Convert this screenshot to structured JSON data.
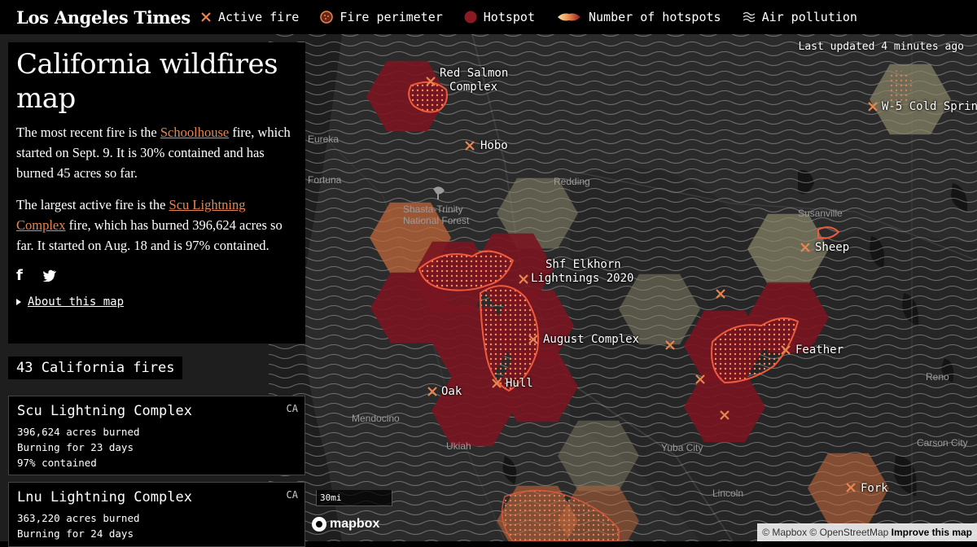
{
  "header": {
    "logo": "Los Angeles Times",
    "legend": [
      {
        "icon": "active-fire-x-icon",
        "label": "Active fire"
      },
      {
        "icon": "fire-perimeter-icon",
        "label": "Fire perimeter"
      },
      {
        "icon": "hotspot-dot-icon",
        "label": "Hotspot"
      },
      {
        "icon": "hotspot-gradient-icon",
        "label": "Number of hotspots"
      },
      {
        "icon": "air-pollution-waves-icon",
        "label": "Air pollution"
      }
    ]
  },
  "panel": {
    "title": "California wildfires map",
    "p1_a": "The most recent fire is the ",
    "p1_link": "Schoolhouse",
    "p1_b": " fire, which started on Sept. 9. It is 30% contained and has burned 45 acres so far.",
    "p2_a": "The largest active fire is the ",
    "p2_link": "Scu Lightning Complex",
    "p2_b": " fire, which has burned 396,624 acres so far. It started on Aug. 18 and is 97% contained.",
    "facebook": "f",
    "twitter": "t",
    "about": "About this map"
  },
  "fire_count": "43 California fires",
  "cards": [
    {
      "name": "Scu Lightning Complex",
      "state": "CA",
      "acres": "396,624 acres burned",
      "duration": "Burning for 23 days",
      "contained": "97% contained"
    },
    {
      "name": "Lnu Lightning Complex",
      "state": "CA",
      "acres": "363,220 acres burned",
      "duration": "Burning for 24 days",
      "contained": ""
    }
  ],
  "map": {
    "updated": "Last updated 4 minutes ago",
    "scale": "30mi",
    "mapbox": "mapbox",
    "attribution_a": "© Mapbox © OpenStreetMap ",
    "attribution_b": "Improve this map",
    "places": [
      "Eureka",
      "Fortuna",
      "Redding",
      "Shasta-Trinity",
      "National Forest",
      "Susanville",
      "Mendocino",
      "Ukiah",
      "Yuba City",
      "Lincoln",
      "Reno",
      "Carson City"
    ],
    "fires": [
      {
        "name": "Red Salmon",
        "name2": "Complex"
      },
      {
        "name": "Hobo"
      },
      {
        "name": "W-5 Cold Sprin"
      },
      {
        "name": "Shf Elkhorn",
        "name2": "Lightnings 2020"
      },
      {
        "name": "Sheep"
      },
      {
        "name": "August Complex"
      },
      {
        "name": "Feather"
      },
      {
        "name": "Oak"
      },
      {
        "name": "Hull"
      },
      {
        "name": "Fork"
      }
    ]
  },
  "colors": {
    "accent": "#e8864f",
    "hex_dark": "#7a1520",
    "hex_orange": "#c0673a",
    "hex_pale": "#8a866a",
    "perimeter": "#f05a3c"
  }
}
